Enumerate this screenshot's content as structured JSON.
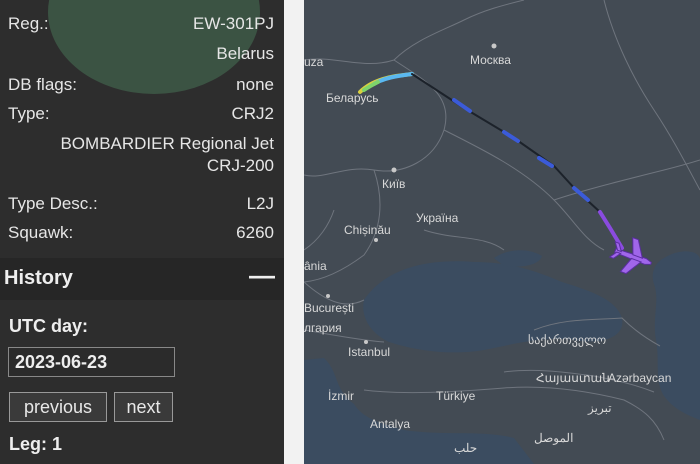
{
  "aircraft": {
    "reg_label": "Reg.:",
    "reg_value": "EW-301PJ",
    "country": "Belarus",
    "db_flags_label": "DB flags:",
    "db_flags_value": "none",
    "type_label": "Type:",
    "type_value": "CRJ2",
    "type_full_line1": "BOMBARDIER Regional Jet",
    "type_full_line2": "CRJ-200",
    "type_desc_label": "Type Desc.:",
    "type_desc_value": "L2J",
    "squawk_label": "Squawk:",
    "squawk_value": "6260"
  },
  "history": {
    "title": "History",
    "toggle": "—",
    "utc_day_label": "UTC day:",
    "utc_day_value": "2023-06-23",
    "previous_label": "previous",
    "next_label": "next",
    "leg_label": "Leg: 1"
  },
  "map": {
    "labels": {
      "ruza": "uza",
      "moskva": "Москва",
      "belarus": "Беларусь",
      "kyiv": "Київ",
      "ukraina": "Україна",
      "chisinau": "Chișinău",
      "ania": "ânia",
      "bucuresti": "București",
      "bulgaria": "лгария",
      "istanbul": "Istanbul",
      "georgia": "საქართველო",
      "armenia": "Հայաստան",
      "azerbaycan": "Azərbaycan",
      "izmir": "İzmir",
      "turkiye": "Türkiye",
      "antalya": "Antalya",
      "tabriz": "تبریز",
      "halab": "حلب",
      "mosul": "الموصل"
    },
    "colors": {
      "water": "#3a4a5c",
      "land": "#434b54",
      "border": "#6a6f78",
      "track": "#222a33",
      "track_blue": "#3b5bd9",
      "track_purple": "#8a4be0",
      "plane": "#a066ea"
    }
  }
}
